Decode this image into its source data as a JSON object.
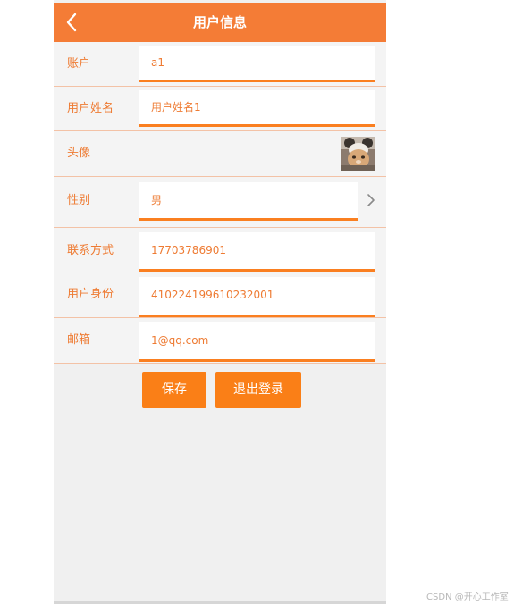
{
  "header": {
    "title": "用户信息"
  },
  "rows": {
    "account": {
      "label": "账户",
      "value": "a1"
    },
    "name": {
      "label": "用户姓名",
      "value": "用户姓名1"
    },
    "avatar": {
      "label": "头像"
    },
    "gender": {
      "label": "性别",
      "value": "男"
    },
    "contact": {
      "label": "联系方式",
      "value": "17703786901"
    },
    "idcard": {
      "label": "用户身份",
      "value": "410224199610232001"
    },
    "email": {
      "label": "邮箱",
      "value": "1@qq.com"
    }
  },
  "actions": {
    "save_label": "保存",
    "logout_label": "退出登录"
  },
  "watermark": "CSDN @开心工作室",
  "colors": {
    "accent": "#f47c36",
    "field_underline": "#fa7f20",
    "label_text": "#ee7b33",
    "page_bg": "#f0f0f0"
  },
  "icons": {
    "back": "chevron-left-icon",
    "gender_select": "chevron-right-icon"
  }
}
